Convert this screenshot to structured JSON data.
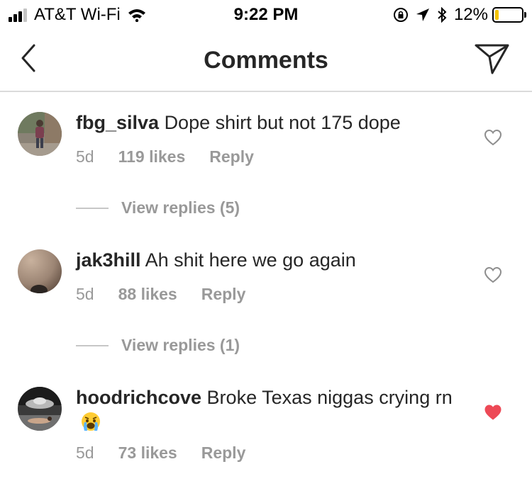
{
  "status_bar": {
    "carrier": "AT&T Wi-Fi",
    "time": "9:22 PM",
    "battery": "12%",
    "battery_level": 0.12
  },
  "header": {
    "title": "Comments"
  },
  "comments": [
    {
      "user": "fbg_silva",
      "text": "Dope shirt but not 175 dope",
      "time": "5d",
      "likes": "119 likes",
      "reply": "Reply",
      "view_replies": "View replies (5)",
      "liked": false
    },
    {
      "user": "jak3hill",
      "text": "Ah shit here we go again",
      "time": "5d",
      "likes": "88 likes",
      "reply": "Reply",
      "view_replies": "View replies (1)",
      "liked": false
    },
    {
      "user": "hoodrichcove",
      "text": "Broke Texas niggas crying rn",
      "time": "5d",
      "likes": "73 likes",
      "reply": "Reply",
      "liked": true,
      "emoji": "crying-face"
    }
  ],
  "colors": {
    "liked_heart": "#ed4956",
    "meta_text": "#999999",
    "divider": "#dbdbdb"
  }
}
